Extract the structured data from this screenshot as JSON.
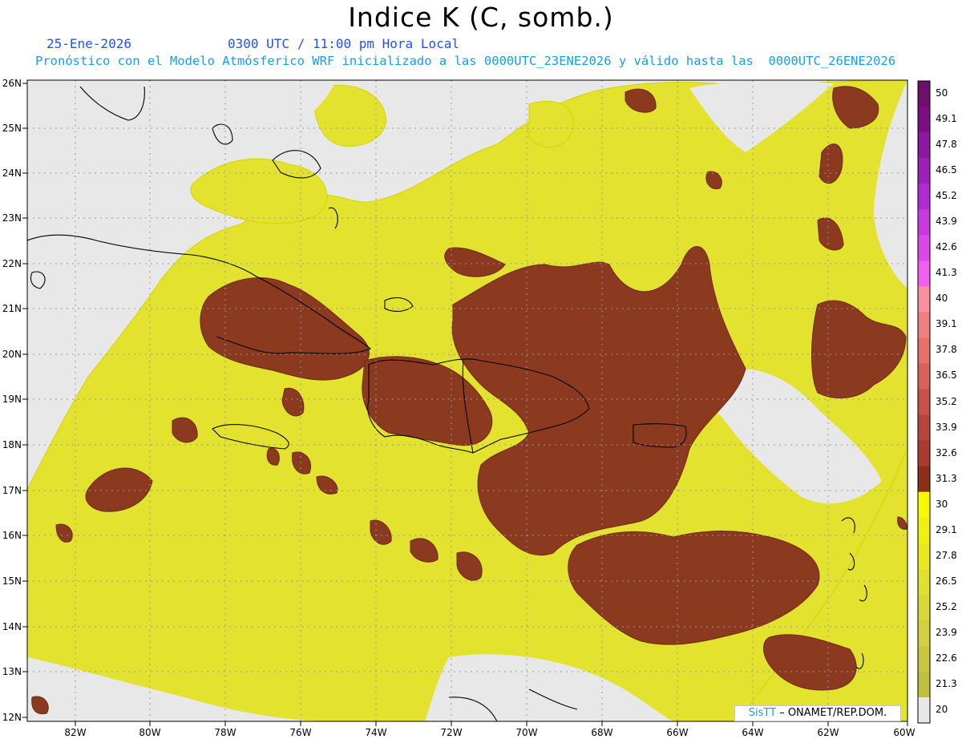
{
  "header": {
    "title": "Indice K (C, somb.)",
    "date": "25-Ene-2026",
    "time": "0300 UTC / 11:00 pm Hora Local",
    "description": "Pronóstico con el Modelo Atmósferico WRF inicializado a las 0000UTC_23ENE2026 y válido hasta las  0000UTC_26ENE2026"
  },
  "axes": {
    "x_ticks": [
      "82W",
      "80W",
      "78W",
      "76W",
      "74W",
      "72W",
      "70W",
      "68W",
      "66W",
      "64W",
      "62W",
      "60W"
    ],
    "y_ticks": [
      "26N",
      "25N",
      "24N",
      "23N",
      "22N",
      "21N",
      "20N",
      "19N",
      "18N",
      "17N",
      "16N",
      "15N",
      "14N",
      "13N",
      "12N"
    ]
  },
  "colorbar": {
    "levels": [
      "50",
      "49.1",
      "47.8",
      "46.5",
      "45.2",
      "43.9",
      "42.6",
      "41.3",
      "40",
      "39.1",
      "37.8",
      "36.5",
      "35.2",
      "33.9",
      "32.6",
      "31.3",
      "30",
      "29.1",
      "27.8",
      "26.5",
      "25.2",
      "23.9",
      "22.6",
      "21.3",
      "20"
    ],
    "colors": [
      "#6a0f6a",
      "#7a107f",
      "#8c18a0",
      "#9c20b8",
      "#b02cd0",
      "#c83ae0",
      "#dc48e8",
      "#f060f0",
      "#f890a0",
      "#f08080",
      "#e87068",
      "#d86058",
      "#c85048",
      "#b84440",
      "#a83a30",
      "#8a3018",
      "#f8f800",
      "#f0f010",
      "#e8e820",
      "#e0e030",
      "#d8d838",
      "#d0d040",
      "#c8c840",
      "#c0c040",
      "#e8e8e8"
    ]
  },
  "credit": {
    "brand": "SisTT",
    "text": " – ONAMET/REP.DOM."
  },
  "colors": {
    "no_data": "#e8e8e8",
    "k_low": "#e0e040",
    "k_high": "#8b3a20"
  }
}
